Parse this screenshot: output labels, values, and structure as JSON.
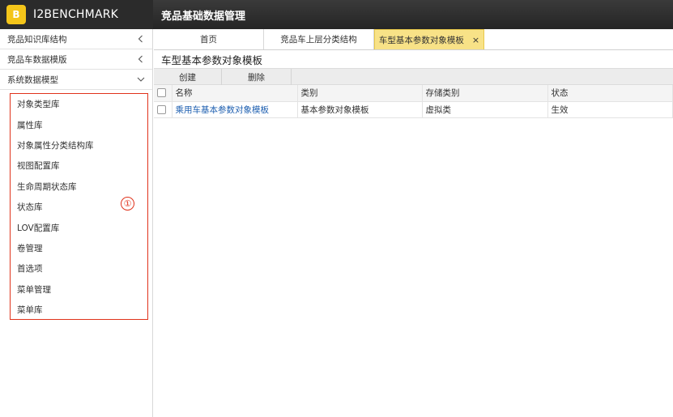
{
  "brand": {
    "logo_text": "B",
    "name": "I2BENCHMARK"
  },
  "header": {
    "title": "竞品基础数据管理"
  },
  "sidebar": {
    "groups": [
      {
        "label": "竞品知识库结构",
        "icon": "chevron-left-icon"
      },
      {
        "label": "竞品车数据模版",
        "icon": "chevron-left-icon"
      },
      {
        "label": "系统数据模型",
        "icon": "chevron-down-icon"
      }
    ],
    "items": [
      {
        "label": "对象类型库"
      },
      {
        "label": "属性库"
      },
      {
        "label": "对象属性分类结构库"
      },
      {
        "label": "视图配置库"
      },
      {
        "label": "生命周期状态库"
      },
      {
        "label": "状态库"
      },
      {
        "label": "LOV配置库"
      },
      {
        "label": "卷管理"
      },
      {
        "label": "首选项"
      },
      {
        "label": "菜单管理"
      },
      {
        "label": "菜单库"
      }
    ],
    "callout": "①",
    "highlight_color": "#e0321b"
  },
  "tabs": [
    {
      "label": "首页",
      "active": false
    },
    {
      "label": "竞品车上层分类结构",
      "active": false
    },
    {
      "label": "车型基本参数对象模板",
      "active": true,
      "close": "×"
    }
  ],
  "page": {
    "title": "车型基本参数对象模板"
  },
  "toolbar": {
    "create_label": "创建",
    "delete_label": "删除"
  },
  "table": {
    "columns": [
      "名称",
      "类别",
      "存储类别",
      "状态"
    ],
    "rows": [
      {
        "name": "乘用车基本参数对象模板",
        "category": "基本参数对象模板",
        "storage": "虚拟类",
        "status": "生效"
      }
    ]
  },
  "colors": {
    "accent_tab": "#f8e287",
    "link": "#1e5fb0",
    "logo": "#f4c51a"
  }
}
